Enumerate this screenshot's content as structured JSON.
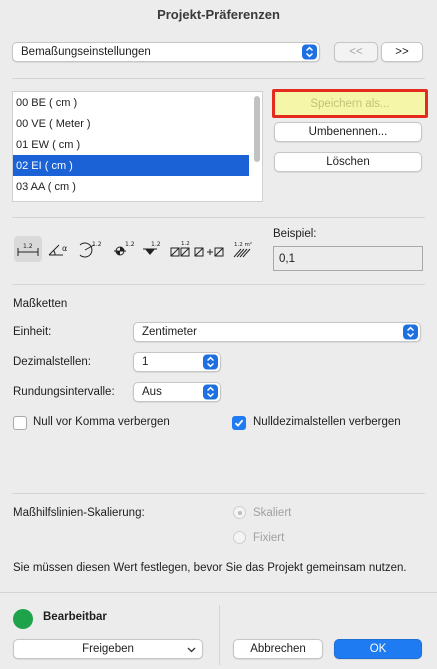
{
  "window": {
    "title": "Projekt-Präferenzen"
  },
  "topbar": {
    "category_select": "Bemaßungseinstellungen",
    "prev_label": "<<",
    "next_label": ">>"
  },
  "presets": {
    "items": [
      {
        "label": "00 BE ( cm )"
      },
      {
        "label": "00 VE ( Meter )"
      },
      {
        "label": "01 EW ( cm )"
      },
      {
        "label": "02 EI ( cm )",
        "selected": true
      },
      {
        "label": "03 AA ( cm )"
      }
    ],
    "save_as_label": "Speichern als...",
    "rename_label": "Umbenennen...",
    "delete_label": "Löschen"
  },
  "toolbar": {
    "icons": [
      "linear-dimension-icon",
      "angle-dimension-icon",
      "radial-dimension-icon",
      "level-dimension-icon",
      "elevation-dimension-icon",
      "door-window-dimension-icon",
      "area-dimension-icon"
    ],
    "icon_texts": [
      "1.2",
      "α",
      "1.2",
      "1.2",
      "1.2",
      "1.2",
      "1.2 m²"
    ]
  },
  "example": {
    "label": "Beispiel:",
    "value": "0,1"
  },
  "section": {
    "title": "Maßketten"
  },
  "unit": {
    "label": "Einheit:",
    "value": "Zentimeter"
  },
  "decimals": {
    "label": "Dezimalstellen:",
    "value": "1"
  },
  "rounding": {
    "label": "Rundungsintervalle:",
    "value": "Aus"
  },
  "options": {
    "hide_leading_zero": {
      "label": "Null vor Komma verbergen",
      "checked": false
    },
    "hide_trailing_zeros": {
      "label": "Nulldezimalstellen verbergen",
      "checked": true
    }
  },
  "scaling": {
    "label": "Maßhilfslinien-Skalierung:",
    "option_scaled": "Skaliert",
    "option_fixed": "Fixiert"
  },
  "note": "Sie müssen diesen Wert festlegen, bevor Sie das Projekt gemeinsam nutzen.",
  "footer": {
    "status_label": "Bearbeitbar",
    "status_color": "#1fa34a",
    "share_label": "Freigeben",
    "cancel_label": "Abbrechen",
    "ok_label": "OK"
  },
  "colors": {
    "accent": "#1f7bf2",
    "highlight_border": "#e52b1e",
    "save_bg": "#f6f6a8"
  }
}
